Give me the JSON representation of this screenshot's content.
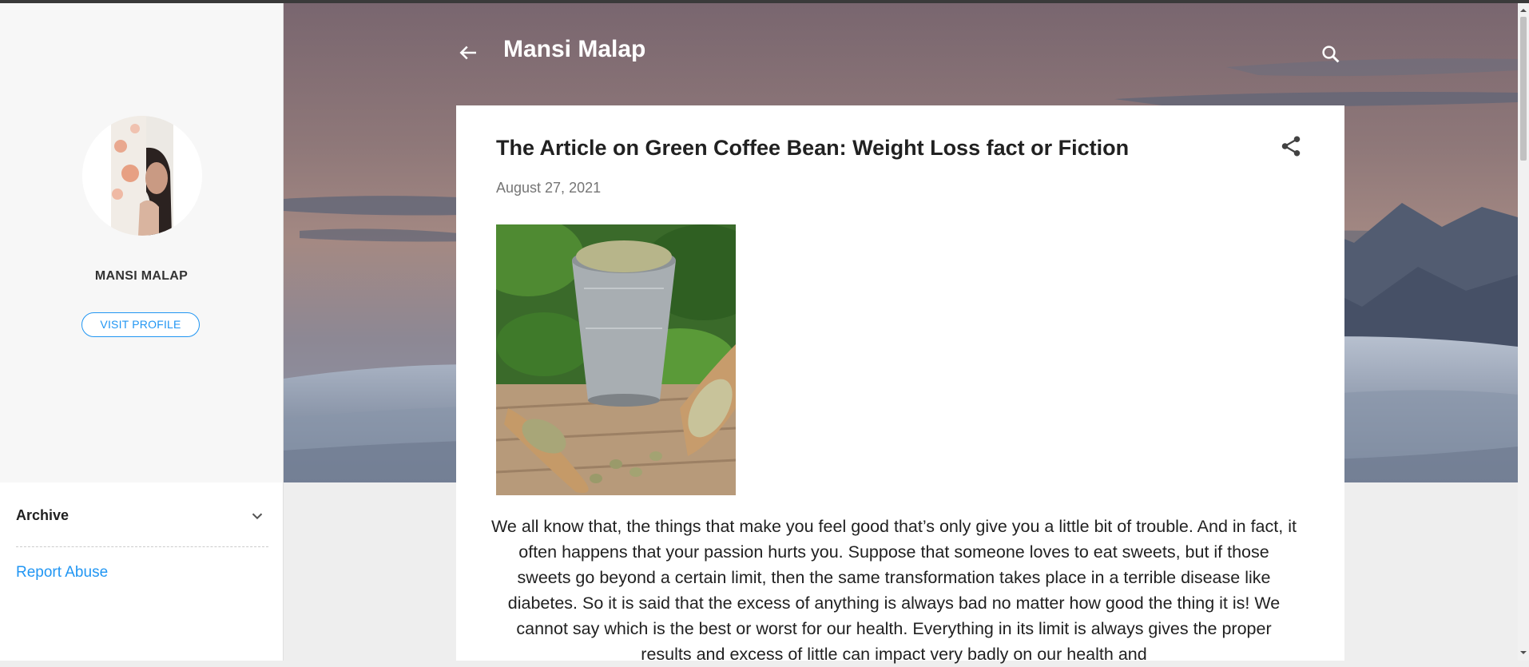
{
  "header": {
    "blog_title": "Mansi Malap",
    "back_icon": "arrow-left-icon",
    "search_icon": "search-icon"
  },
  "sidebar": {
    "profile_name": "MANSI MALAP",
    "visit_profile_label": "VISIT PROFILE",
    "archive_label": "Archive",
    "archive_icon": "chevron-down-icon",
    "report_abuse_label": "Report Abuse"
  },
  "post": {
    "title": "The Article on Green Coffee Bean: Weight Loss fact or Fiction",
    "date": "August 27, 2021",
    "share_icon": "share-icon",
    "body": "We all know that, the things that make you feel good that’s only give you a little bit of trouble. And in fact, it often happens that your passion hurts you. Suppose that someone loves to eat sweets, but if those sweets go beyond a certain limit, then the same transformation takes place in a terrible disease like diabetes. So it is said that the excess of anything is always bad no matter how good the thing it is! We cannot say which is the best or worst for our health. Everything in its limit is always gives the proper results and excess of little can impact very badly on our health and"
  },
  "colors": {
    "accent": "#2196f3",
    "sidebar_bg": "#f7f7f7",
    "page_bg": "#eeeeee",
    "title_text": "#212121",
    "date_text": "#757575"
  }
}
